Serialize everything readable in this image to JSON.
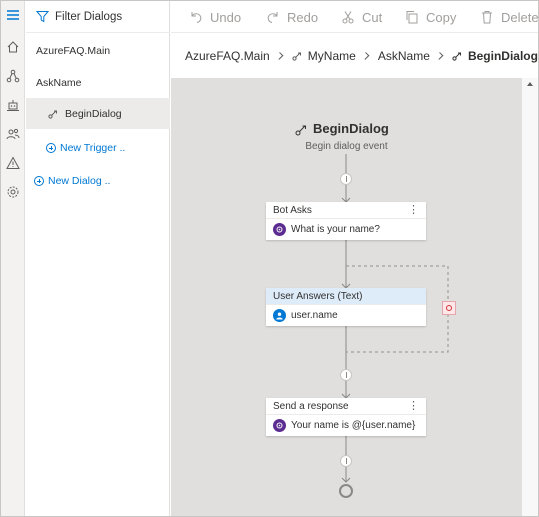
{
  "rail": {
    "icons": [
      "menu-icon",
      "home-icon",
      "flow-icon",
      "bot-icon",
      "users-icon",
      "warning-icon",
      "settings-icon"
    ]
  },
  "tree": {
    "filter_label": "Filter Dialogs",
    "items": [
      {
        "label": "AzureFAQ.Main"
      },
      {
        "label": "AskName"
      },
      {
        "label": "BeginDialog"
      }
    ],
    "new_trigger_label": "New Trigger ..",
    "new_dialog_label": "New Dialog .."
  },
  "toolbar": {
    "undo_label": "Undo",
    "redo_label": "Redo",
    "cut_label": "Cut",
    "copy_label": "Copy",
    "delete_label": "Delete"
  },
  "breadcrumb": {
    "items": [
      "AzureFAQ.Main",
      "MyName",
      "AskName",
      "BeginDialog"
    ]
  },
  "flow": {
    "trigger_title": "BeginDialog",
    "trigger_subtitle": "Begin dialog event",
    "cards": [
      {
        "header": "Bot Asks",
        "body": "What is your name?"
      },
      {
        "header": "User Answers (Text)",
        "body": "user.name"
      },
      {
        "header": "Send a response",
        "body": "Your name is @{user.name}"
      }
    ]
  },
  "colors": {
    "accent": "#0078d4",
    "selected_row": "#edebe9",
    "canvas": "#e1dfdd",
    "card_header_blue": "#deecf9",
    "badge_purple": "#5c2d91",
    "disabled_text": "#a19f9d"
  }
}
